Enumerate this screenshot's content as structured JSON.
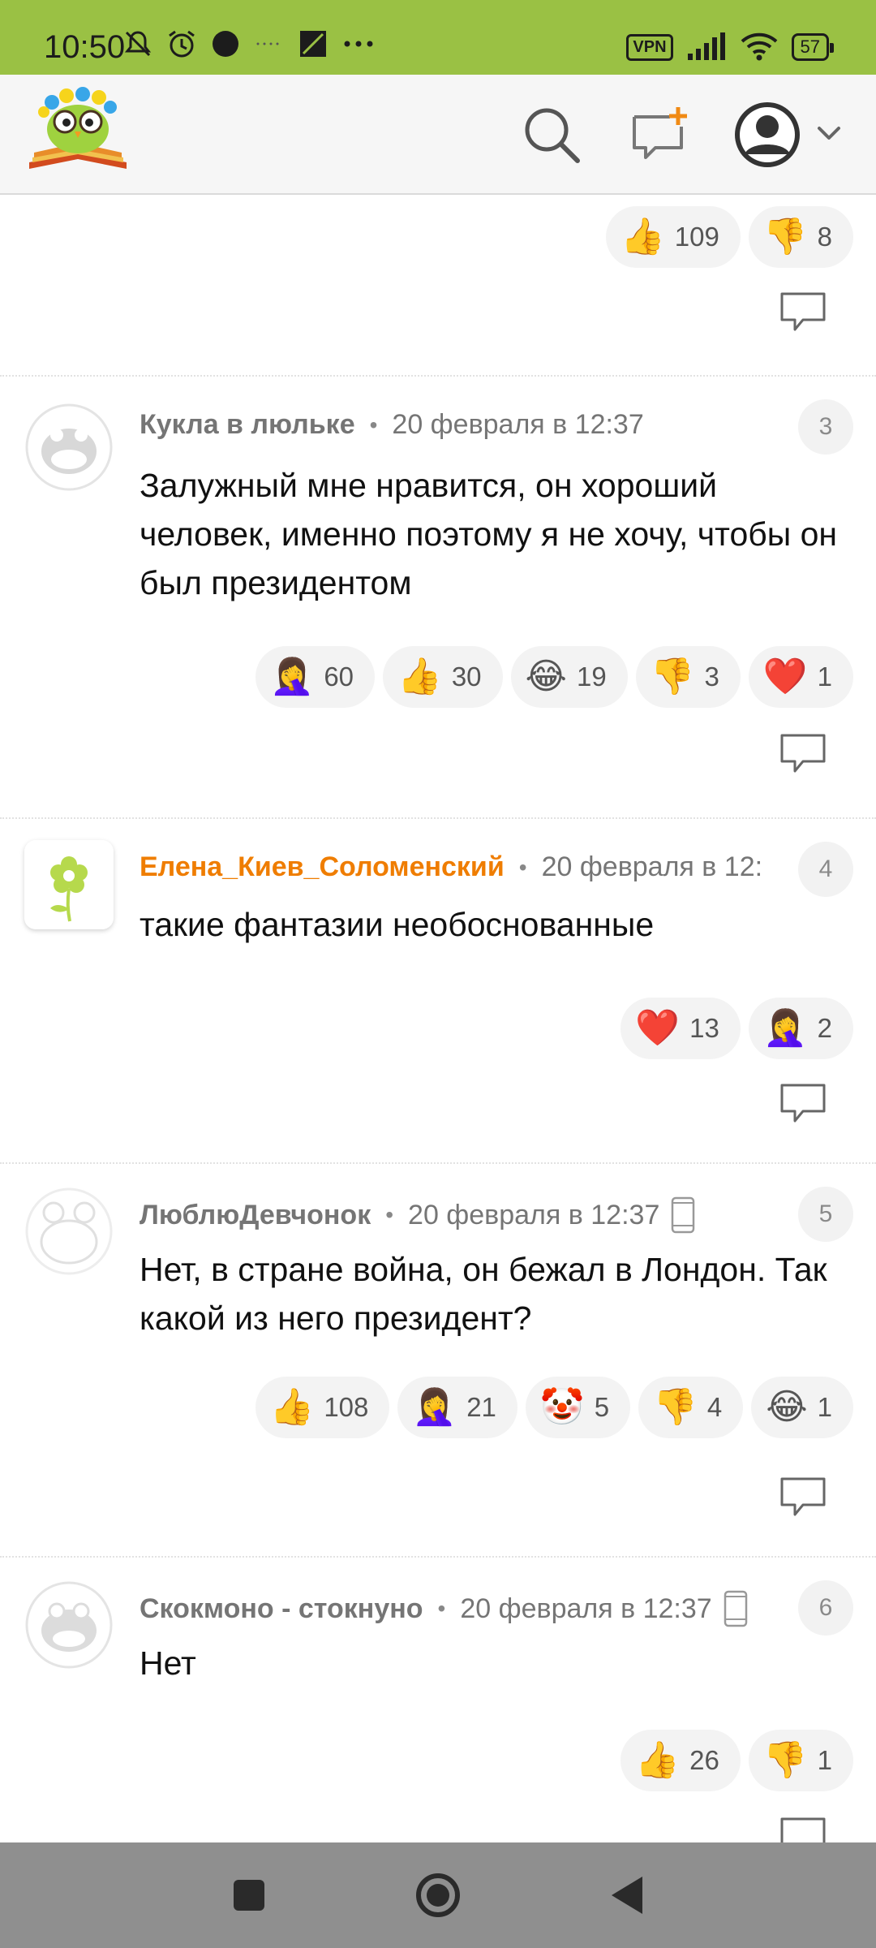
{
  "status_bar": {
    "time": "10:50",
    "icons_left": [
      "mute-icon",
      "alarm-icon",
      "dot-icon",
      "sim-icon",
      "more-icon"
    ],
    "vpn": "VPN",
    "battery": "57"
  },
  "header": {
    "logo": "owl-book-logo",
    "icons": [
      "search-icon",
      "new-chat-icon",
      "user-avatar-icon",
      "chevron-down-icon"
    ]
  },
  "top_partial": {
    "reactions": [
      {
        "icon": "👍",
        "count": "109"
      },
      {
        "icon": "👎",
        "count": "8"
      }
    ]
  },
  "comments": [
    {
      "author": "Кукла в люльке",
      "date": "20 февраля в 12:37",
      "number": "3",
      "text": "Залужный мне нравится, он хороший человек, именно поэтому я не хочу, чтобы он был президентом",
      "reactions": [
        {
          "icon": "🤦‍♀️",
          "count": "60"
        },
        {
          "icon": "👍",
          "count": "30"
        },
        {
          "icon": "😂",
          "count": "19"
        },
        {
          "icon": "👎",
          "count": "3"
        },
        {
          "icon": "❤️",
          "count": "1"
        }
      ]
    },
    {
      "author": "Елена_Киев_Соломенский",
      "date": "20 февраля в 12:",
      "number": "4",
      "text": "такие фантазии необоснованные",
      "reactions": [
        {
          "icon": "❤️",
          "count": "13"
        },
        {
          "icon": "🤦‍♀️",
          "count": "2"
        }
      ]
    },
    {
      "author": "ЛюблюДевчонок",
      "date": "20 февраля в 12:37",
      "number": "5",
      "text": "Нет, в стране война, он бежал в Лондон. Так какой из него президент?",
      "reactions": [
        {
          "icon": "👍",
          "count": "108"
        },
        {
          "icon": "🤦‍♀️",
          "count": "21"
        },
        {
          "icon": "🤡",
          "count": "5"
        },
        {
          "icon": "👎",
          "count": "4"
        },
        {
          "icon": "😂",
          "count": "1"
        }
      ]
    },
    {
      "author": "Скокмоно - стокнуно",
      "date": "20 февраля в 12:37",
      "number": "6",
      "text": "Нет",
      "reactions": [
        {
          "icon": "👍",
          "count": "26"
        },
        {
          "icon": "👎",
          "count": "1"
        }
      ]
    }
  ],
  "nav_bar": [
    "recents-button",
    "home-button",
    "back-button"
  ]
}
